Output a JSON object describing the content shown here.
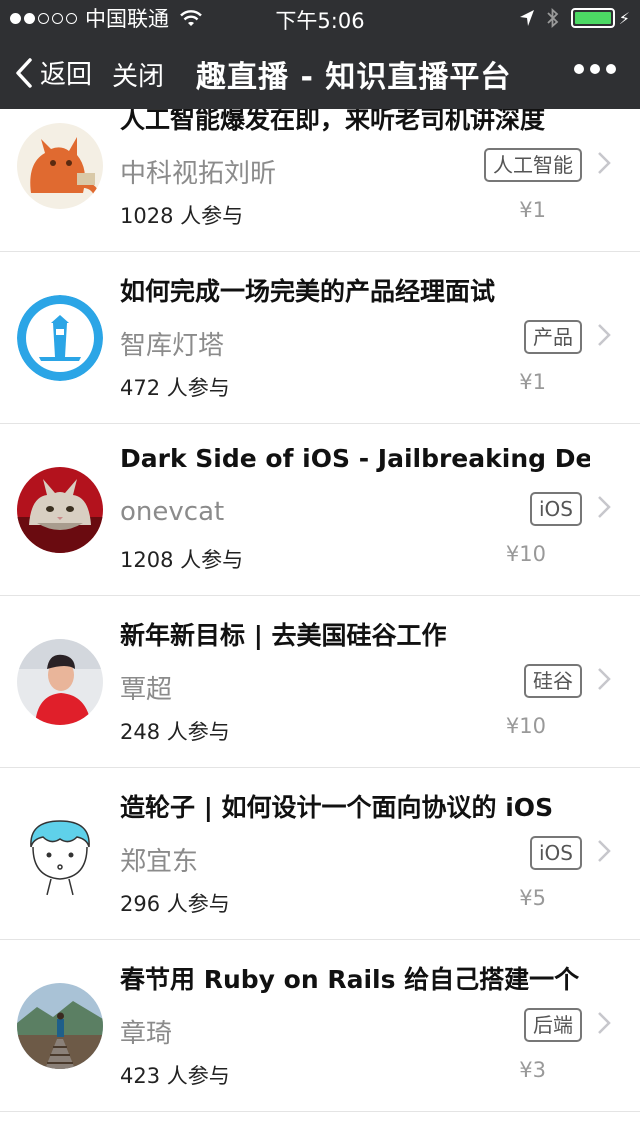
{
  "status_bar": {
    "carrier": "中国联通",
    "time": "下午5:06"
  },
  "nav": {
    "back_label": "返回",
    "close_label": "关闭",
    "title": "趣直播 - 知识直播平台"
  },
  "items": [
    {
      "title": "人工智能爆发在即，来听老司机讲深度",
      "author": "中科视拓刘昕",
      "tag": "人工智能",
      "participants": "1028 人参与",
      "price": "¥1"
    },
    {
      "title": "如何完成一场完美的产品经理面试",
      "author": "智库灯塔",
      "tag": "产品",
      "participants": "472 人参与",
      "price": "¥1"
    },
    {
      "title": "Dark Side of iOS - Jailbreaking Dev",
      "author": "onevcat",
      "tag": "iOS",
      "participants": "1208 人参与",
      "price": "¥10"
    },
    {
      "title": "新年新目标 | 去美国硅谷工作",
      "author": "覃超",
      "tag": "硅谷",
      "participants": "248 人参与",
      "price": "¥10"
    },
    {
      "title": "造轮子 | 如何设计一个面向协议的 iOS",
      "author": "郑宜东",
      "tag": "iOS",
      "participants": "296 人参与",
      "price": "¥5"
    },
    {
      "title": "春节用 Ruby on Rails 给自己搭建一个",
      "author": "章琦",
      "tag": "后端",
      "participants": "423 人参与",
      "price": "¥3"
    }
  ]
}
